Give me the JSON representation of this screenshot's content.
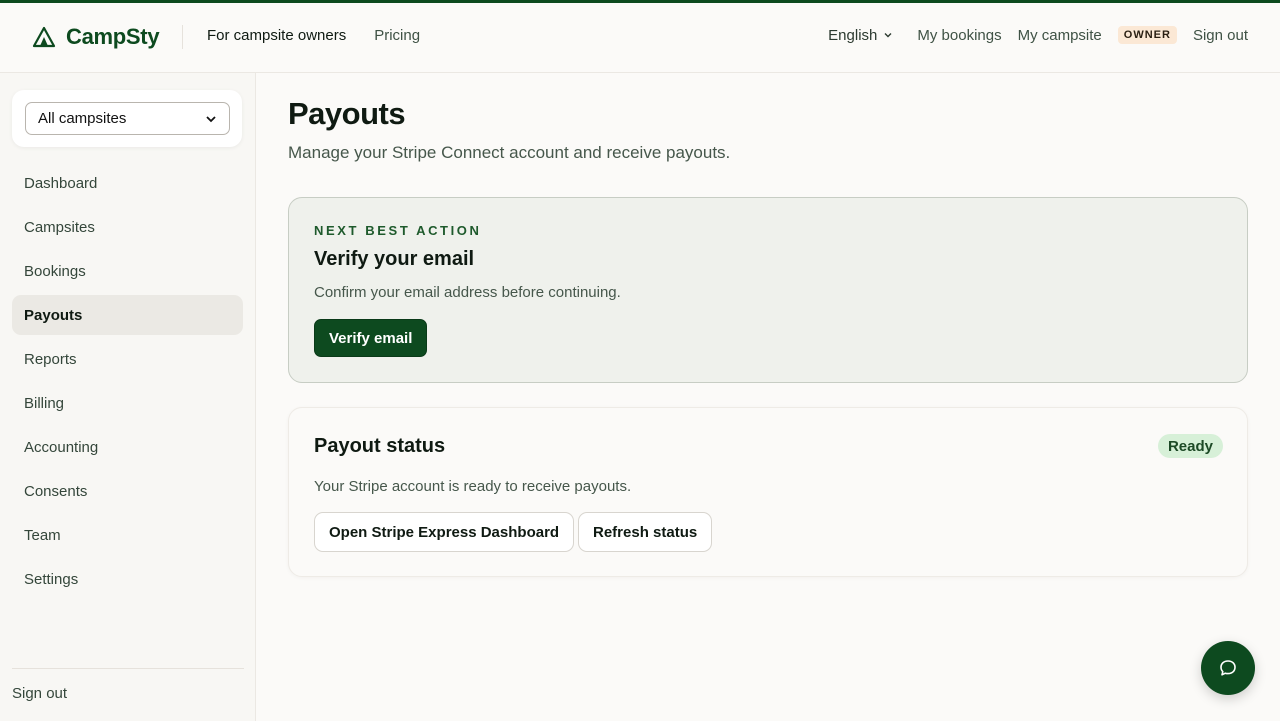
{
  "header": {
    "brand": "CampSty",
    "nav_left": [
      "For campsite owners",
      "Pricing"
    ],
    "language": "English",
    "my_bookings": "My bookings",
    "my_campsite": "My campsite",
    "role_badge": "OWNER",
    "sign_out": "Sign out"
  },
  "sidebar": {
    "campsite_select": "All campsites",
    "items": [
      {
        "label": "Dashboard"
      },
      {
        "label": "Campsites"
      },
      {
        "label": "Bookings"
      },
      {
        "label": "Payouts"
      },
      {
        "label": "Reports"
      },
      {
        "label": "Billing"
      },
      {
        "label": "Accounting"
      },
      {
        "label": "Consents"
      },
      {
        "label": "Team"
      },
      {
        "label": "Settings"
      }
    ],
    "active": "Payouts",
    "sign_out": "Sign out"
  },
  "main": {
    "title": "Payouts",
    "subtitle": "Manage your Stripe Connect account and receive payouts.",
    "next_action": {
      "eyebrow": "NEXT BEST ACTION",
      "title": "Verify your email",
      "description": "Confirm your email address before continuing.",
      "button": "Verify email"
    },
    "payout_status": {
      "title": "Payout status",
      "status": "Ready",
      "description": "Your Stripe account is ready to receive payouts.",
      "buttons": [
        "Open Stripe Express Dashboard",
        "Refresh status"
      ]
    }
  },
  "colors": {
    "brand_green": "#0d4a1f",
    "ready_bg": "#d7f0d8",
    "owner_badge_bg": "#fbe8d5"
  },
  "icons": {
    "logo": "tent-icon",
    "language": "chevron-down-icon",
    "select": "chevron-down-icon",
    "fab": "chat-bubble-icon"
  }
}
